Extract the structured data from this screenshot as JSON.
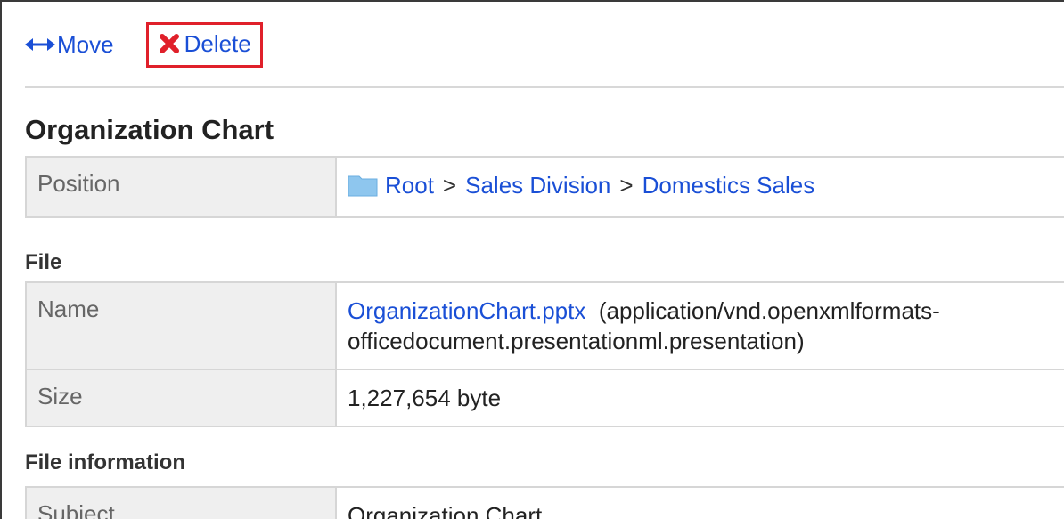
{
  "toolbar": {
    "move_label": "Move",
    "delete_label": "Delete"
  },
  "title": "Organization Chart",
  "position": {
    "label": "Position",
    "breadcrumb": [
      "Root",
      "Sales Division",
      "Domestics Sales"
    ],
    "separator": ">"
  },
  "file_section": {
    "heading": "File",
    "name_label": "Name",
    "file_name": "OrganizationChart.pptx",
    "mime_line1": "(application/vnd.openxmlformats-",
    "mime_line2": "officedocument.presentationml.presentation)",
    "size_label": "Size",
    "size_value": "1,227,654 byte"
  },
  "info_section": {
    "heading": "File information",
    "subject_label": "Subject",
    "subject_value": "Organization Chart"
  },
  "colors": {
    "link": "#1a4fd6",
    "highlight_border": "#e0202a",
    "label_bg": "#efefef",
    "folder": "#8ec6ee"
  },
  "icons": {
    "move": "double-arrow-icon",
    "delete": "red-x-icon",
    "folder": "folder-icon"
  }
}
